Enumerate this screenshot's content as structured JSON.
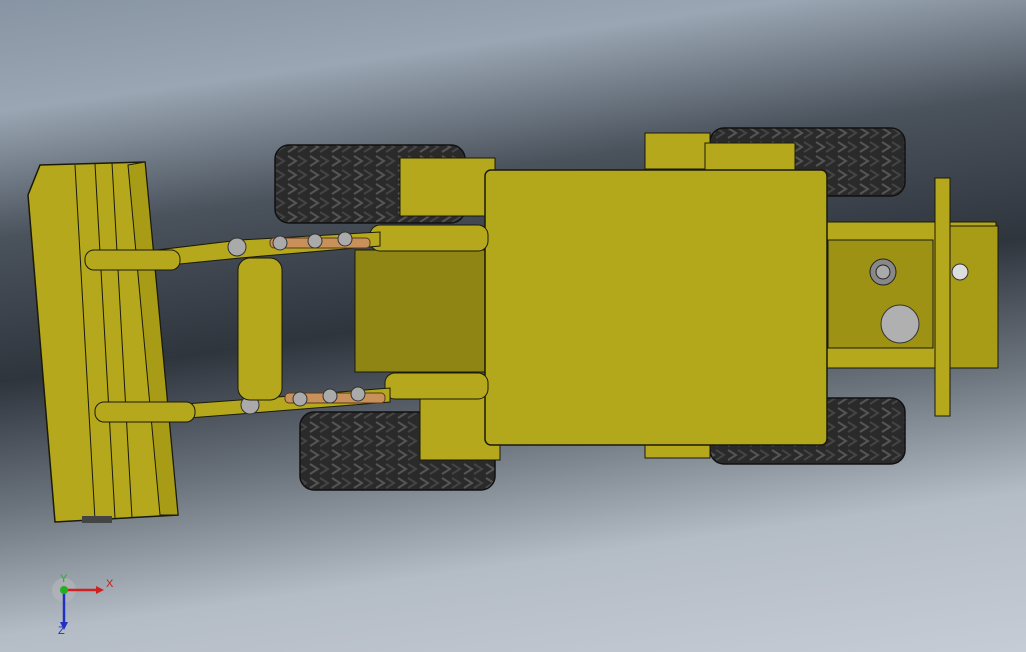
{
  "viewport": {
    "background_top": "#8794a3",
    "background_mid": "#2f353d",
    "background_bottom": "#c6ccd5"
  },
  "model": {
    "body_color": "#b5a81c",
    "body_shadow": "#8f8514",
    "tire_color": "#2a2a2a",
    "rod_color": "#c8905a",
    "outline_color": "#1a1a0a",
    "parts": [
      "bucket",
      "lift-arm-upper",
      "lift-arm-lower",
      "cross-tube",
      "front-tire-top",
      "front-tire-bottom",
      "rear-tire-top",
      "rear-tire-bottom",
      "cab-roof",
      "engine-hood",
      "counterweight",
      "hydraulic-cylinder-upper",
      "hydraulic-cylinder-lower"
    ]
  },
  "triad": {
    "x_label": "X",
    "y_label": "Y",
    "z_label": "Z",
    "x_color": "#d02020",
    "y_color": "#20b020",
    "z_color": "#2030c0"
  }
}
